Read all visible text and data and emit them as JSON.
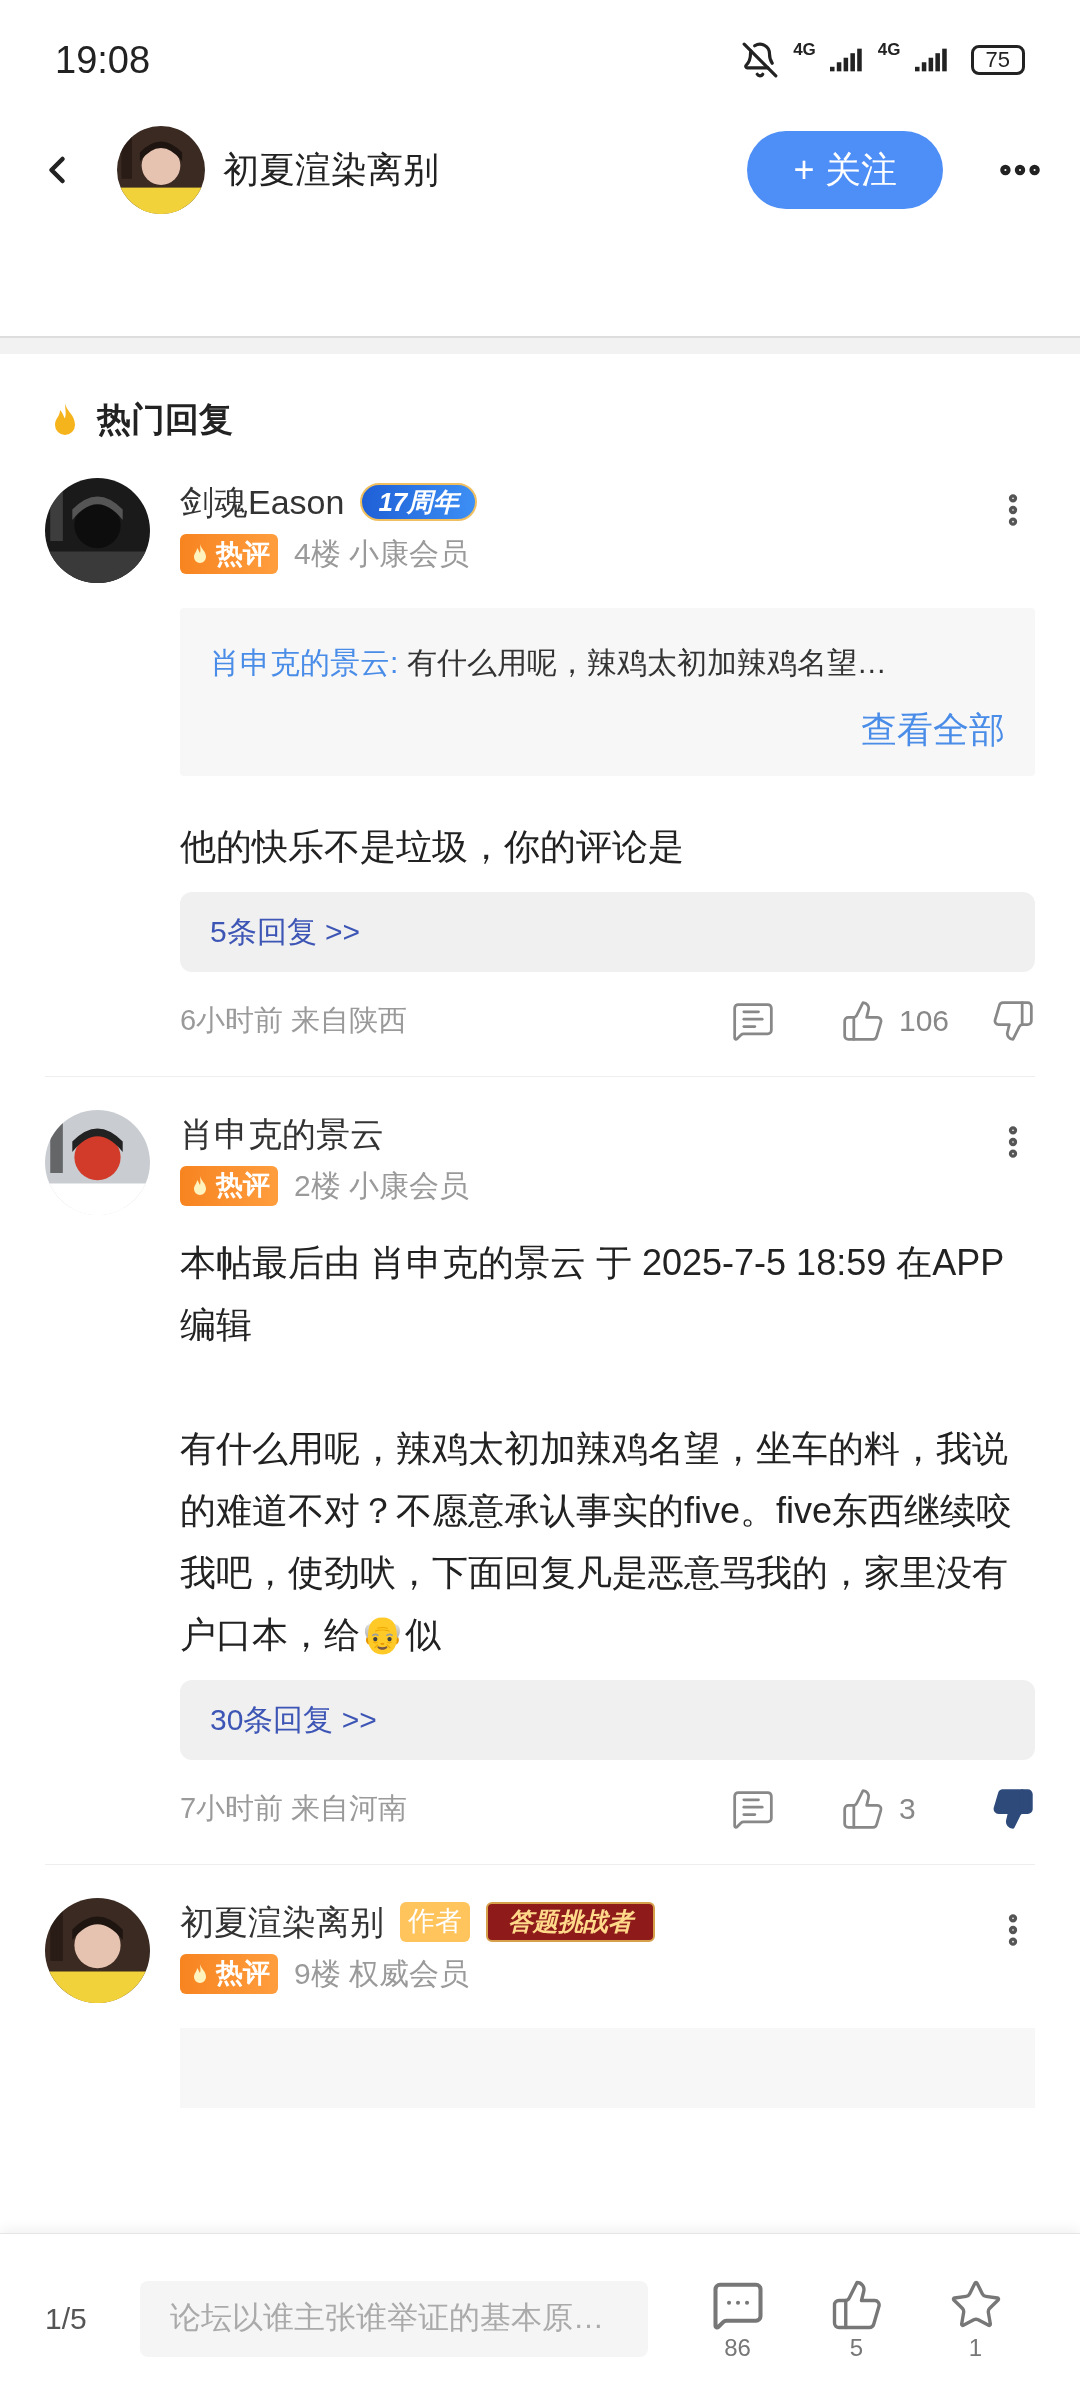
{
  "status_bar": {
    "time": "19:08",
    "network_1": "4G",
    "network_2": "4G",
    "battery": "75"
  },
  "header": {
    "author_name": "初夏渲染离别",
    "follow_button": "+ 关注"
  },
  "section_title": "热门回复",
  "comments": [
    {
      "name": "剑魂Eason",
      "badges": [
        {
          "kind": "anniversary",
          "text": "17周年"
        }
      ],
      "hot_tag": "热评",
      "floor": "4楼",
      "level": "小康会员",
      "quote": {
        "author": "肖申克的景云:",
        "text": "有什么用呢，辣鸡太初加辣鸡名望…",
        "more": "查看全部"
      },
      "body": [
        "他的快乐不是垃圾，你的评论是"
      ],
      "replies": "5条回复 >>",
      "time": "6小时前",
      "location": "来自陕西",
      "likes": "106",
      "disliked": false
    },
    {
      "name": "肖申克的景云",
      "hot_tag": "热评",
      "floor": "2楼",
      "level": "小康会员",
      "body": [
        "本帖最后由 肖申克的景云 于 2025-7-5 18:59 在APP 编辑",
        "有什么用呢，辣鸡太初加辣鸡名望，坐车的料，我说的难道不对？不愿意承认事实的five。five东西继续咬我吧，使劲吠，下面回复凡是恶意骂我的，家里没有户口本，给👴似"
      ],
      "replies": "30条回复 >>",
      "time": "7小时前",
      "location": "来自河南",
      "likes": "3",
      "disliked": true
    },
    {
      "name": "初夏渲染离别",
      "badges": [
        {
          "kind": "author",
          "text": "作者"
        },
        {
          "kind": "challenger",
          "text": "答题挑战者"
        }
      ],
      "hot_tag": "热评",
      "floor": "9楼",
      "level": "权威会员",
      "quote_cut": true
    }
  ],
  "bottom_bar": {
    "page": "1/5",
    "placeholder": "论坛以谁主张谁举证的基本原…",
    "comments": "86",
    "likes": "5",
    "favorites": "1"
  }
}
